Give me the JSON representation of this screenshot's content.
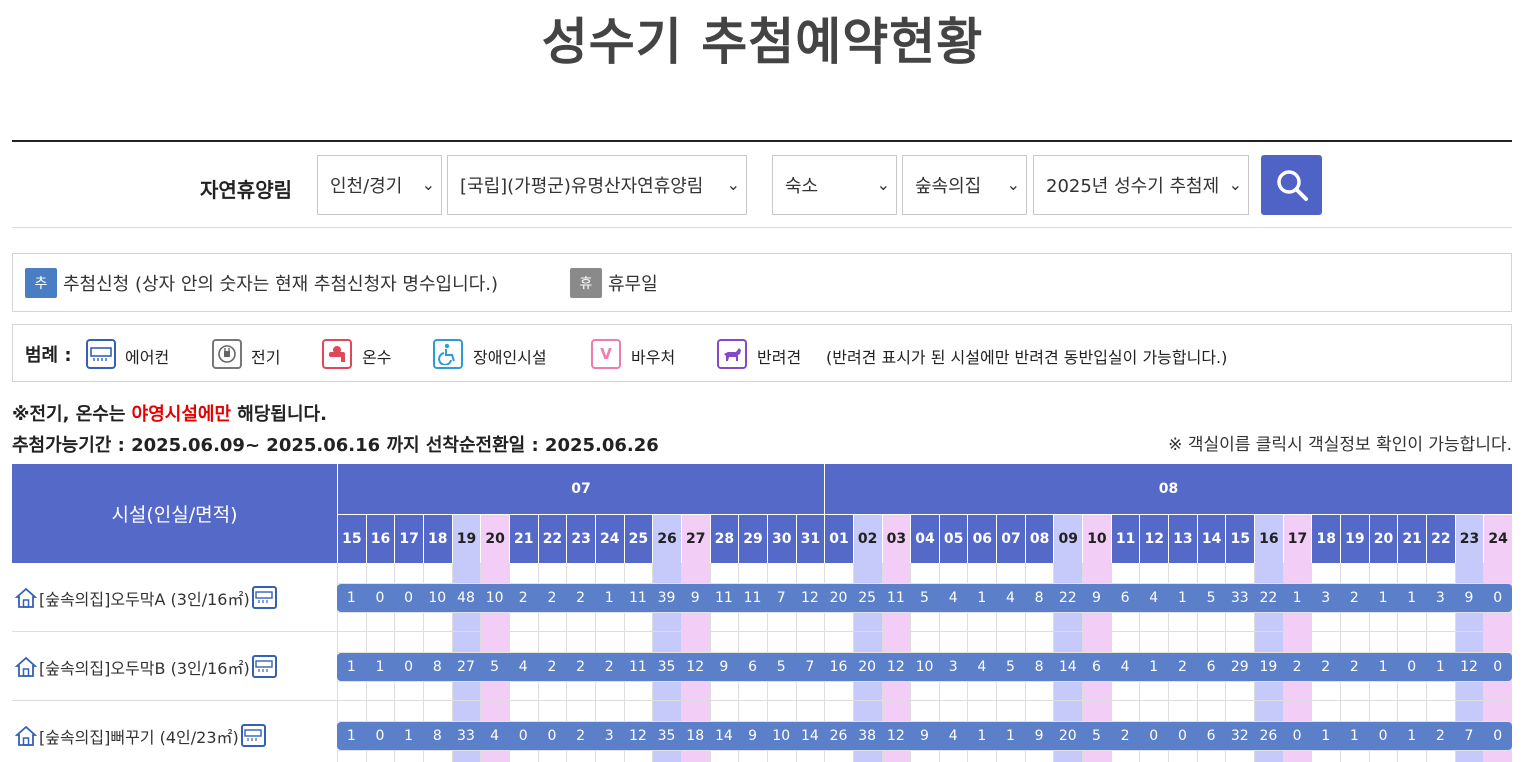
{
  "title": "성수기 추첨예약현황",
  "search": {
    "label": "자연휴양림",
    "region": "인천/경기",
    "forest": "[국립](가평군)유명산자연휴양림",
    "category": "숙소",
    "type": "숲속의집",
    "period": "2025년 성수기 추첨제"
  },
  "legend1": {
    "apply_badge": "추",
    "apply_text": "추첨신청 (상자 안의 숫자는 현재 추첨신청자 명수입니다.)",
    "closed_badge": "휴",
    "closed_text": "휴무일"
  },
  "legend2": {
    "title": "범례 :",
    "items": [
      "에어컨",
      "전기",
      "온수",
      "장애인시설",
      "바우처",
      "반려견"
    ],
    "pet_note": "(반려견 표시가 된 시설에만 반려견 동반입실이 가능합니다.)"
  },
  "notes": {
    "prefix": "※전기, 온수는 ",
    "highlight": "야영시설에만",
    "suffix": " 해당됩니다.",
    "period": "추첨가능기간 : 2025.06.09~ 2025.06.16 까지 선착순전환일 : 2025.06.26",
    "room_info": "※ 객실이름 클릭시 객실정보 확인이 가능합니다."
  },
  "table": {
    "facility_header": "시설(인실/면적)",
    "months": [
      {
        "label": "07",
        "days": [
          "15",
          "16",
          "17",
          "18",
          "19",
          "20",
          "21",
          "22",
          "23",
          "24",
          "25",
          "26",
          "27",
          "28",
          "29",
          "30",
          "31"
        ]
      },
      {
        "label": "08",
        "days": [
          "01",
          "02",
          "03",
          "04",
          "05",
          "06",
          "07",
          "08",
          "09",
          "10",
          "11",
          "12",
          "13",
          "14",
          "15",
          "16",
          "17",
          "18",
          "19",
          "20",
          "21",
          "22",
          "23",
          "24"
        ]
      }
    ],
    "day_kinds": [
      "w",
      "w",
      "w",
      "w",
      "sat",
      "sun",
      "w",
      "w",
      "w",
      "w",
      "w",
      "sat",
      "sun",
      "w",
      "w",
      "w",
      "w",
      "w",
      "sat",
      "sun",
      "w",
      "w",
      "w",
      "w",
      "w",
      "sat",
      "sun",
      "w",
      "w",
      "w",
      "w",
      "w",
      "sat",
      "sun",
      "w",
      "w",
      "w",
      "w",
      "w",
      "sat",
      "sun"
    ],
    "rows": [
      {
        "name": "[숲속의집]오두막A (3인/16㎡)",
        "counts": [
          "1",
          "0",
          "0",
          "10",
          "48",
          "10",
          "2",
          "2",
          "2",
          "1",
          "11",
          "39",
          "9",
          "11",
          "11",
          "7",
          "12",
          "20",
          "25",
          "11",
          "5",
          "4",
          "1",
          "4",
          "8",
          "22",
          "9",
          "6",
          "4",
          "1",
          "5",
          "33",
          "22",
          "1",
          "3",
          "2",
          "1",
          "1",
          "3",
          "9",
          "0"
        ]
      },
      {
        "name": "[숲속의집]오두막B (3인/16㎡)",
        "counts": [
          "1",
          "1",
          "0",
          "8",
          "27",
          "5",
          "4",
          "2",
          "2",
          "2",
          "11",
          "35",
          "12",
          "9",
          "6",
          "5",
          "7",
          "16",
          "20",
          "12",
          "10",
          "3",
          "4",
          "5",
          "8",
          "14",
          "6",
          "4",
          "1",
          "2",
          "6",
          "29",
          "19",
          "2",
          "2",
          "2",
          "1",
          "0",
          "1",
          "12",
          "0"
        ]
      },
      {
        "name": "[숲속의집]뻐꾸기 (4인/23㎡)",
        "counts": [
          "1",
          "0",
          "1",
          "8",
          "33",
          "4",
          "0",
          "0",
          "2",
          "3",
          "12",
          "35",
          "18",
          "14",
          "9",
          "10",
          "14",
          "26",
          "38",
          "12",
          "9",
          "4",
          "1",
          "1",
          "9",
          "20",
          "5",
          "2",
          "0",
          "0",
          "6",
          "32",
          "26",
          "0",
          "1",
          "1",
          "0",
          "1",
          "2",
          "7",
          "0"
        ]
      }
    ]
  },
  "colors": {
    "header": "#5569c8",
    "saturday": "#c5cafb",
    "sunday": "#f2cdf6",
    "bar": "#5b7fc8",
    "search_button": "#4f63c7"
  }
}
